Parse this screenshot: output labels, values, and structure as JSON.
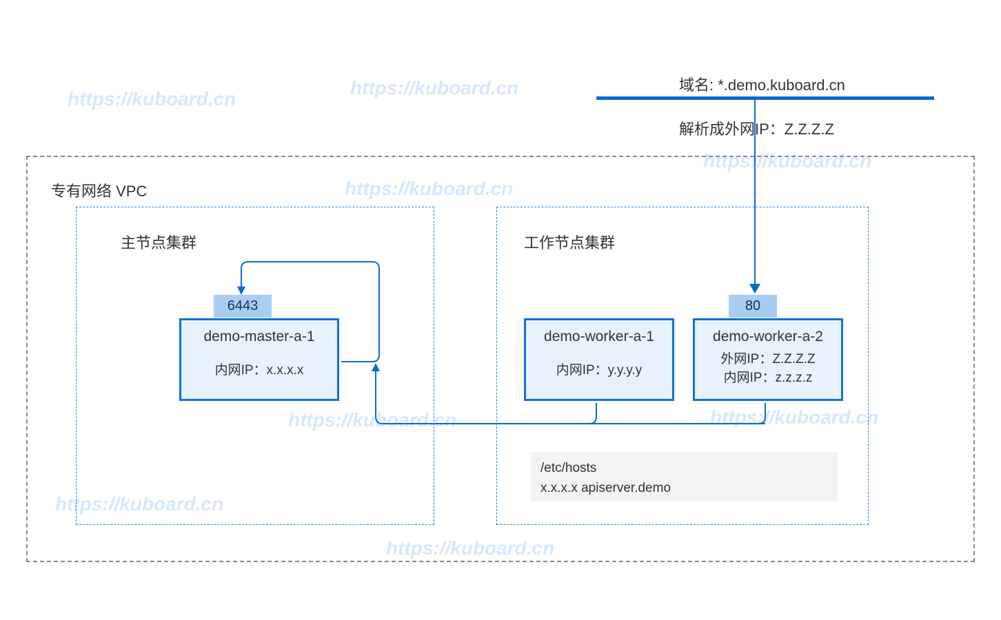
{
  "watermarks": {
    "wm1": "https://kuboard.cn",
    "wm2": "https://kuboard.cn",
    "wm3": "https://kuboard.cn",
    "wm4": "https://kuboard.cn",
    "wm5": "https://kuboard.cn",
    "wm6": "https://kuboard.cn",
    "wm7": "https://kuboard.cn",
    "wm8": "https://kuboard.cn"
  },
  "domain_label": "域名:  *.demo.kuboard.cn",
  "resolve_label": "解析成外网IP：Z.Z.Z.Z",
  "vpc_label": "专有网络 VPC",
  "master_cluster_label": "主节点集群",
  "worker_cluster_label": "工作节点集群",
  "ports": {
    "p6443": "6443",
    "p80": "80"
  },
  "nodes": {
    "master": {
      "name": "demo-master-a-1",
      "intranet": "内网IP：x.x.x.x"
    },
    "w1": {
      "name": "demo-worker-a-1",
      "intranet": "内网IP：y.y.y.y"
    },
    "w2": {
      "name": "demo-worker-a-2",
      "extranet": "外网IP：Z.Z.Z.Z",
      "intranet": "内网IP：z.z.z.z"
    }
  },
  "hosts": {
    "line1": "/etc/hosts",
    "line2": "x.x.x.x       apiserver.demo"
  }
}
